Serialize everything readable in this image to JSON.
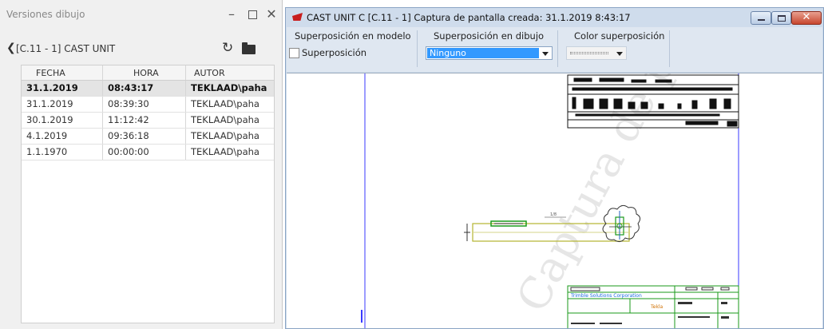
{
  "left_panel": {
    "title": "Versiones dibujo",
    "breadcrumb": "[C.11 - 1] CAST UNIT",
    "columns": [
      "FECHA",
      "HORA",
      "AUTOR"
    ],
    "rows": [
      {
        "fecha": "31.1.2019",
        "hora": "08:43:17",
        "autor": "TEKLAAD\\paha"
      },
      {
        "fecha": "31.1.2019",
        "hora": "08:39:30",
        "autor": "TEKLAAD\\paha"
      },
      {
        "fecha": "30.1.2019",
        "hora": "11:12:42",
        "autor": "TEKLAAD\\paha"
      },
      {
        "fecha": "4.1.2019",
        "hora": "09:36:18",
        "autor": "TEKLAAD\\paha"
      },
      {
        "fecha": "1.1.1970",
        "hora": "00:00:00",
        "autor": "TEKLAAD\\paha"
      }
    ],
    "icons": {
      "refresh": "refresh-icon",
      "folder": "folder-icon",
      "back": "chevron-left-icon"
    }
  },
  "right_window": {
    "title": "CAST UNIT C  [C.11 - 1]  Captura de pantalla creada: 31.1.2019 8:43:17",
    "toolbar": {
      "model_overlay_label": "Superposición en modelo",
      "overlay_checkbox_label": "Superposición",
      "drawing_overlay_label": "Superposición en dibujo",
      "drawing_overlay_value": "Ninguno",
      "color_overlay_label": "Color superposición"
    },
    "drawing": {
      "watermark": "Captura de pa",
      "title_block_company": "Trimble Solutions Corporation",
      "title_block_field": "Tekla"
    }
  },
  "colors": {
    "selected_row": "#e4e4e4",
    "selection_blue": "#3399ff",
    "frame_blue": "#cfdcec",
    "close_red": "#c7462e"
  }
}
